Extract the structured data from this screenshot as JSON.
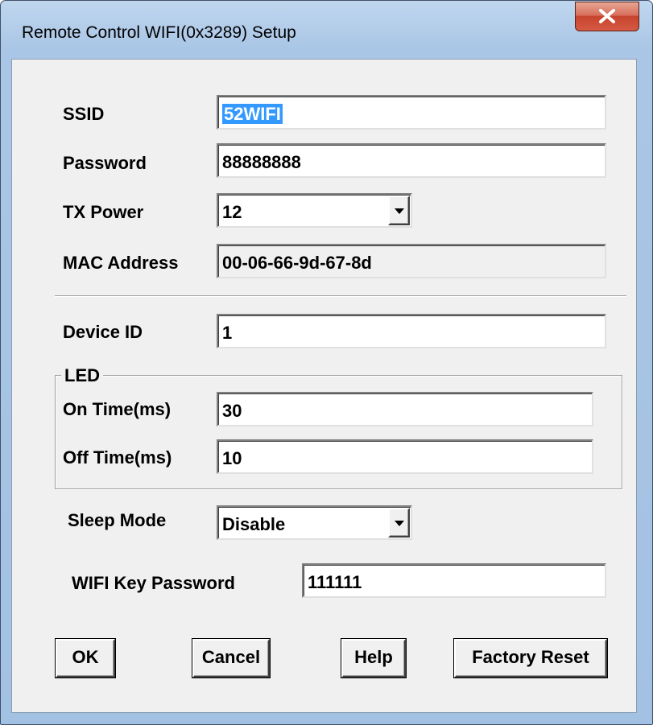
{
  "window": {
    "title": "Remote Control WIFI(0x3289) Setup",
    "close_icon": "close-x-icon",
    "title_gradient": [
      "#bfd6ee",
      "#a3c1e3"
    ],
    "close_color": "#c6442c"
  },
  "form": {
    "ssid": {
      "label": "SSID",
      "value": "52WIFI"
    },
    "password": {
      "label": "Password",
      "value": "88888888"
    },
    "tx_power": {
      "label": "TX Power",
      "value": "12"
    },
    "mac_address": {
      "label": "MAC Address",
      "value": "00-06-66-9d-67-8d"
    },
    "device_id": {
      "label": "Device ID",
      "value": "1"
    },
    "led": {
      "group_label": "LED",
      "on_time": {
        "label": "On Time(ms)",
        "value": "30"
      },
      "off_time": {
        "label": "Off Time(ms)",
        "value": "10"
      }
    },
    "sleep_mode": {
      "label": "Sleep Mode",
      "value": "Disable"
    },
    "wifi_key_password": {
      "label": "WIFI Key Password",
      "value": "111111"
    }
  },
  "buttons": {
    "ok": "OK",
    "cancel": "Cancel",
    "help": "Help",
    "factory_reset": "Factory Reset"
  },
  "colors": {
    "selection": "#3399ff",
    "dialog_bg": "#f0f0f0"
  }
}
